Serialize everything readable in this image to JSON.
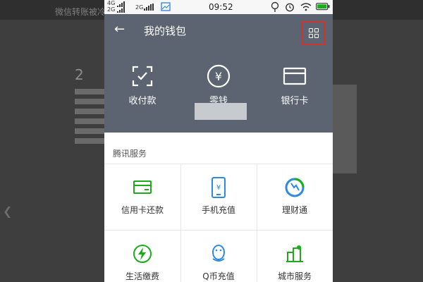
{
  "background_page": {
    "header_text": "微信转账被冷",
    "step": "2"
  },
  "status_bar": {
    "signal_1": "4G",
    "signal_2": "2G",
    "signal_3": "2G",
    "time": "09:52"
  },
  "wallet": {
    "title": "我的钱包",
    "header_items": [
      {
        "label": "收付款",
        "icon": "scan-pay-icon"
      },
      {
        "label": "零钱",
        "icon": "yuan-coin-icon"
      },
      {
        "label": "银行卡",
        "icon": "bank-card-icon"
      }
    ],
    "section_title": "腾讯服务",
    "services": [
      {
        "label": "信用卡还款",
        "icon": "credit-card-icon"
      },
      {
        "label": "手机充值",
        "icon": "phone-recharge-icon"
      },
      {
        "label": "理财通",
        "icon": "wealth-icon"
      },
      {
        "label": "生活缴费",
        "icon": "lightning-icon"
      },
      {
        "label": "Q币充值",
        "icon": "qq-penguin-icon"
      },
      {
        "label": "城市服务",
        "icon": "city-icon"
      }
    ]
  },
  "colors": {
    "header_bg": "#5b6470",
    "accent_green": "#1aad19",
    "accent_blue": "#2b8be0",
    "highlight_red": "#d0342c"
  }
}
